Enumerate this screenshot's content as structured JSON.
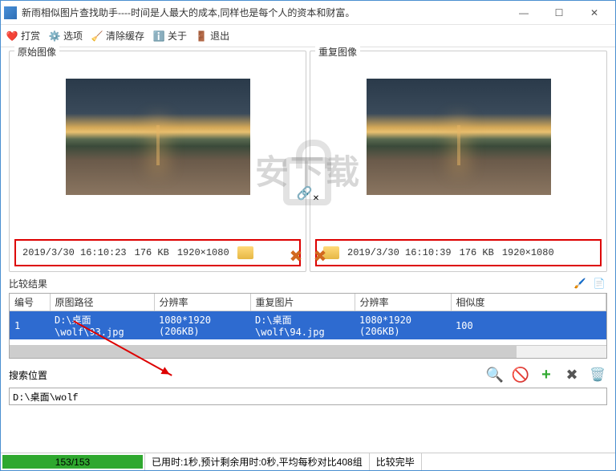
{
  "window": {
    "title": "新雨相似图片查找助手----时间是人最大的成本,同样也是每个人的资本和财富。"
  },
  "toolbar": {
    "open": "打赏",
    "options": "选项",
    "clear_cache": "清除缓存",
    "about": "关于",
    "exit": "退出"
  },
  "panels": {
    "left_title": "原始图像",
    "right_title": "重复图像",
    "left_info": {
      "datetime": "2019/3/30 16:10:23",
      "size": "176 KB",
      "dims": "1920×1080"
    },
    "right_info": {
      "datetime": "2019/3/30 16:10:39",
      "size": "176 KB",
      "dims": "1920×1080"
    }
  },
  "compare": {
    "label": "比较结果",
    "headers": {
      "id": "编号",
      "orig": "原图路径",
      "res1": "分辨率",
      "dup": "重复图片",
      "res2": "分辨率",
      "sim": "相似度"
    },
    "row": {
      "id": "1",
      "orig": "D:\\桌面\\wolf\\93.jpg",
      "res1": "1080*1920 (206KB)",
      "dup": "D:\\桌面\\wolf\\94.jpg",
      "res2": "1080*1920 (206KB)",
      "sim": "100"
    }
  },
  "search": {
    "label": "搜索位置",
    "path": "D:\\桌面\\wolf"
  },
  "status": {
    "progress": "153/153",
    "timing": "已用时:1秒,预计剩余用时:0秒,平均每秒对比408组",
    "state": "比较完毕"
  },
  "watermark": "安下载"
}
